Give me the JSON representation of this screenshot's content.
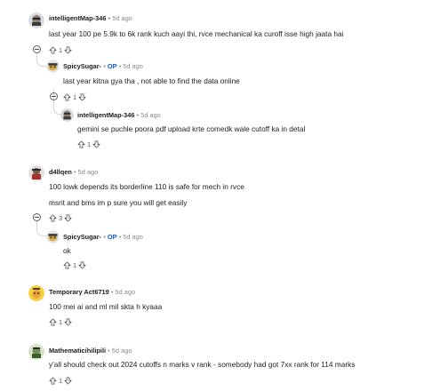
{
  "comments": [
    {
      "user": "intelligentMap-346",
      "op": "",
      "time": "5d ago",
      "text": "last year 100 pe 5.9k to 6k rank kuch aayi thi, rvce mechanical ka curoff isse high jaata hai",
      "score": "1"
    },
    {
      "user": "SpicySugar-",
      "op": "OP",
      "time": "5d ago",
      "text": "last year kitna gya tha , not able to find the data online",
      "score": "1"
    },
    {
      "user": "intelligentMap-346",
      "op": "",
      "time": "5d ago",
      "text": "gemini se puchle poora pdf upload krte comedk wale cutoff ka in detal",
      "score": "1"
    },
    {
      "user": "d4llqen",
      "op": "",
      "time": "5d ago",
      "text": "100 lowk depends its borderline 110 is safe for mech in rvce",
      "text2": "msrit and bms im p sure you will get easily",
      "score": "3"
    },
    {
      "user": "SpicySugar-",
      "op": "OP",
      "time": "5d ago",
      "text": "ok",
      "score": "1"
    },
    {
      "user": "Temporary Act6719",
      "op": "",
      "time": "5d ago",
      "text": "100 mei ai and ml mil skta h kyaaa",
      "score": "1"
    },
    {
      "user": "Mathematicihilipili",
      "op": "",
      "time": "5d ago",
      "text": "y'all should check out 2024 cutoffs n marks v rank - somebody had got 7xx rank for 114 marks",
      "score": "1"
    }
  ],
  "separator": "•",
  "icons": {
    "upvote": "arrow-up-icon",
    "downvote": "arrow-down-icon",
    "collapse": "collapse-icon"
  }
}
